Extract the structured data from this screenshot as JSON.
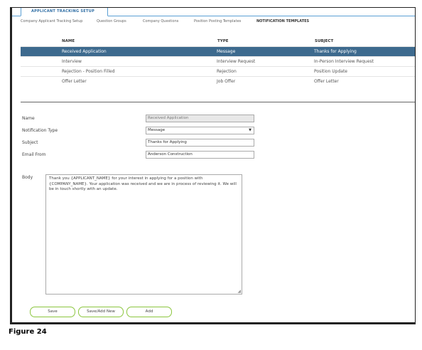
{
  "top_tab": "APPLICANT TRACKING SETUP",
  "subtabs": [
    {
      "label": "Company Applicant Tracking Setup",
      "active": false
    },
    {
      "label": "Question Groups",
      "active": false
    },
    {
      "label": "Company Questions",
      "active": false
    },
    {
      "label": "Position Posting Templates",
      "active": false
    },
    {
      "label": "NOTIFICATION TEMPLATES",
      "active": true
    }
  ],
  "table": {
    "headers": [
      "NAME",
      "TYPE",
      "SUBJECT"
    ],
    "rows": [
      {
        "name": "Received Application",
        "type": "Message",
        "subject": "Thanks for Applying",
        "selected": true
      },
      {
        "name": "Interview",
        "type": "Interview Request",
        "subject": "In-Person Interview Request",
        "selected": false
      },
      {
        "name": "Rejection - Position Filled",
        "type": "Rejection",
        "subject": "Position Update",
        "selected": false
      },
      {
        "name": "Offer Letter",
        "type": "Job Offer",
        "subject": "Offer Letter",
        "selected": false
      }
    ]
  },
  "form": {
    "name_label": "Name",
    "name_value": "Received Application",
    "type_label": "Notification Type",
    "type_value": "Message",
    "subject_label": "Subject",
    "subject_value": "Thanks for Applying",
    "email_label": "Email From",
    "email_value": "Anderson Construction",
    "body_label": "Body",
    "body_value": "Thank you {APPLICANT_NAME} for your interest in applying for a position with {COMPANY_NAME}. Your application was received and we are in process of reviewing it. We will be in touch shortly with an update."
  },
  "buttons": {
    "save": "Save",
    "save_add_new": "Save/Add New",
    "add": "Add"
  },
  "caption": "Figure 24"
}
